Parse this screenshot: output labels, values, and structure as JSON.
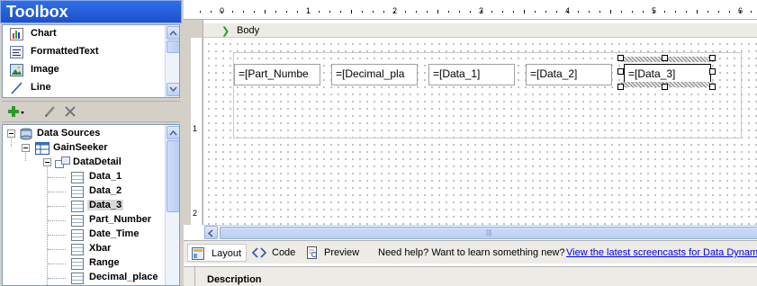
{
  "toolbox": {
    "title": "Toolbox",
    "items": [
      {
        "label": "Chart",
        "icon": "chart-icon"
      },
      {
        "label": "FormattedText",
        "icon": "formatted-text-icon"
      },
      {
        "label": "Image",
        "icon": "image-icon"
      },
      {
        "label": "Line",
        "icon": "line-icon"
      }
    ]
  },
  "data_sources": {
    "root": "Data Sources",
    "source": "GainSeeker",
    "dataset": "DataDetail",
    "fields": [
      "Data_1",
      "Data_2",
      "Data_3",
      "Part_Number",
      "Date_Time",
      "Xbar",
      "Range",
      "Decimal_place"
    ],
    "selected_field": "Data_3"
  },
  "ruler": {
    "top_labels": [
      "0",
      "1",
      "2",
      "3",
      "4",
      "5",
      "6"
    ],
    "left_labels": [
      "1",
      "2"
    ]
  },
  "band": {
    "label": "Body"
  },
  "report": {
    "textboxes": [
      "=[Part_Numbe",
      "=[Decimal_pla",
      "=[Data_1]",
      "=[Data_2]",
      "=[Data_3]"
    ]
  },
  "bottom_tabs": {
    "layout": "Layout",
    "code": "Code",
    "preview": "Preview",
    "help_text": "Need help? Want to learn something new?",
    "help_link": "View the latest screencasts for Data Dynamic"
  },
  "description": {
    "label": "Description"
  },
  "colors": {
    "toolbox_header": "#1d4fcf",
    "link": "#0000ee"
  }
}
